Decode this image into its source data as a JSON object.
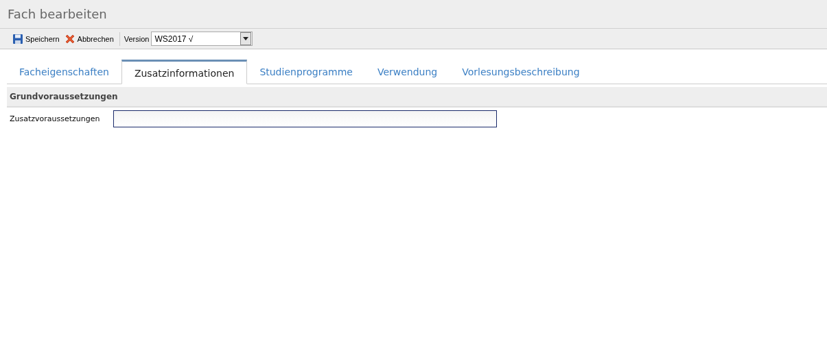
{
  "window": {
    "title": "Fach bearbeiten"
  },
  "toolbar": {
    "buttons": [
      {
        "kind": "save",
        "label": "Speichern"
      },
      {
        "kind": "cancel",
        "label": "Abbrechen"
      }
    ],
    "version": {
      "label": "Version",
      "value": "WS2017 √"
    }
  },
  "tabs": [
    {
      "label": "Facheigenschaften",
      "selected": false
    },
    {
      "label": "Zusatzinformationen",
      "selected": true
    },
    {
      "label": "Studienprogramme",
      "selected": false
    },
    {
      "label": "Verwendung",
      "selected": false
    },
    {
      "label": "Vorlesungsbeschreibung",
      "selected": false
    }
  ],
  "section": {
    "title": "Grundvoraussetzungen",
    "fields": [
      {
        "label": "Zusatzvoraussetzungen"
      }
    ]
  }
}
